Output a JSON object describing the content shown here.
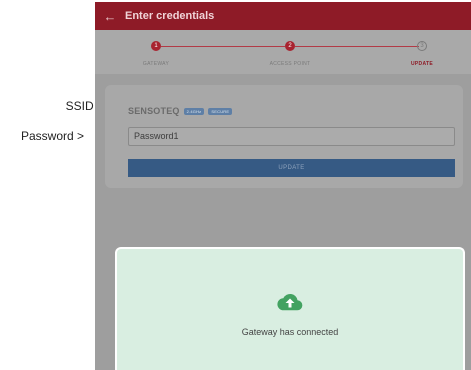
{
  "annotations": {
    "ssid": "SSID >",
    "password": "Password >"
  },
  "appbar": {
    "title": "Enter credentials",
    "back_icon": "arrow-left-icon"
  },
  "stepper": {
    "steps": [
      {
        "number": "1",
        "label": "GATEWAY",
        "state": "done"
      },
      {
        "number": "2",
        "label": "ACCESS POINT",
        "state": "done"
      },
      {
        "number": "3",
        "label": "UPDATE",
        "state": "active"
      }
    ],
    "accent": "#b23a46"
  },
  "card": {
    "ssid_name": "SENSOTEQ",
    "badges": [
      "2.4GHz",
      "SECURE"
    ],
    "password_value": "Password1",
    "update_label": "UPDATE"
  },
  "toast": {
    "icon": "cloud-upload-icon",
    "message": "Gateway has connected",
    "icon_color": "#43a261"
  }
}
